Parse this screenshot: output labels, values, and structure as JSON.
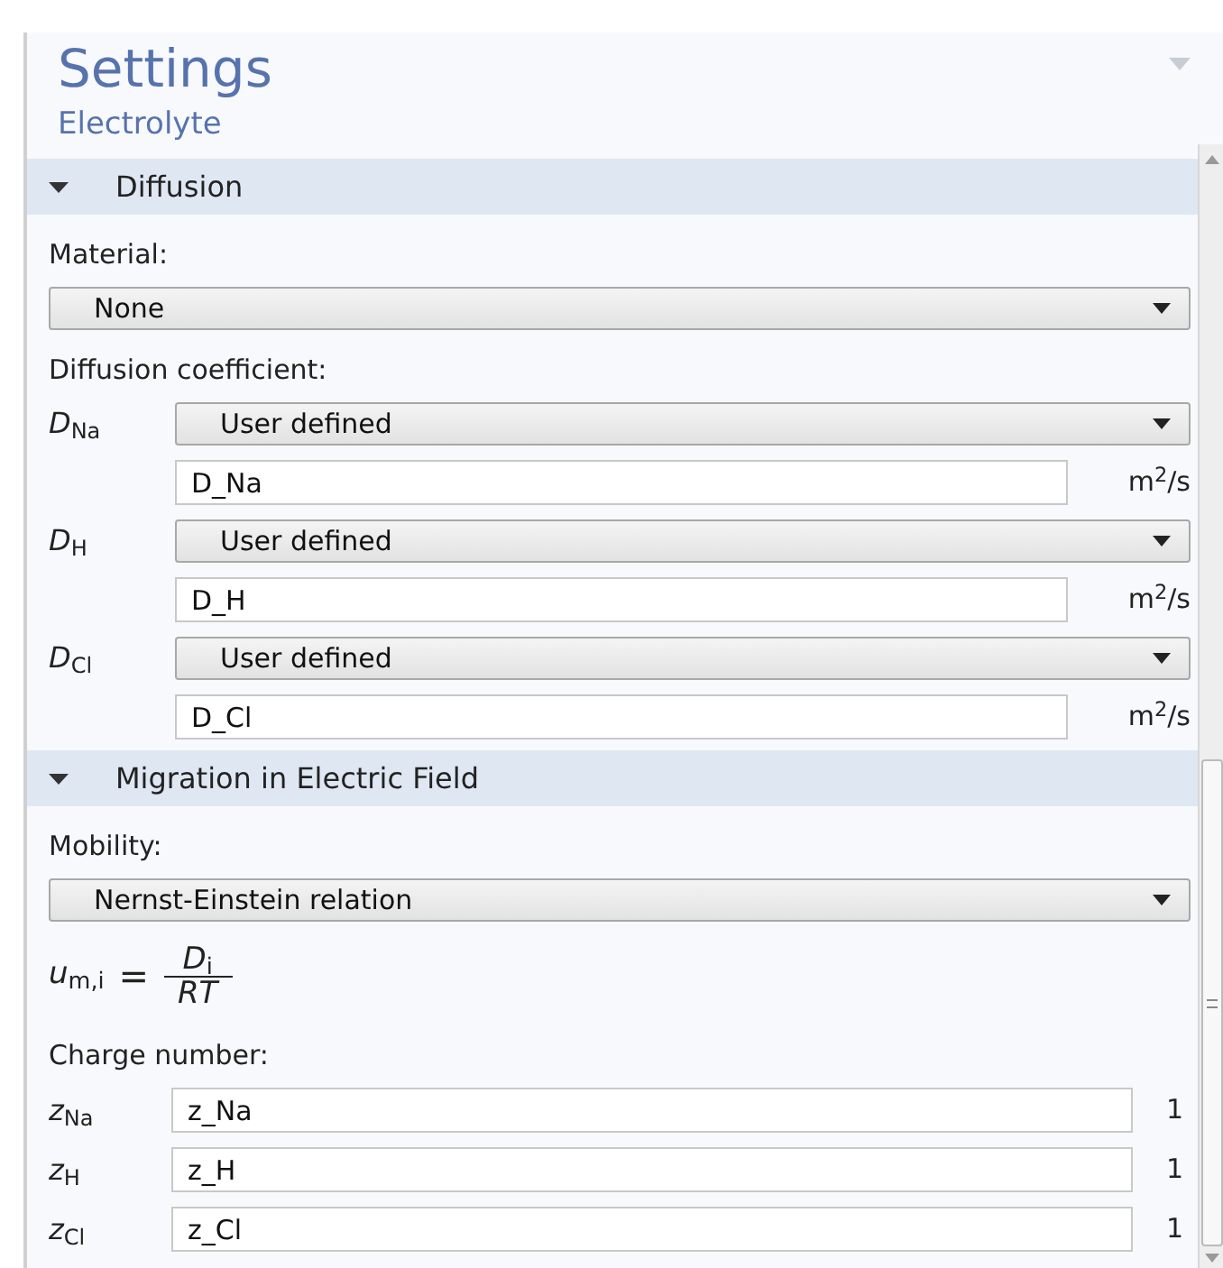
{
  "panel": {
    "title": "Settings",
    "subtitle": "Electrolyte"
  },
  "sections": [
    {
      "title": "Diffusion",
      "expanded": true,
      "items": [
        {
          "kind": "label",
          "text": "Material:"
        },
        {
          "kind": "select",
          "value": "None"
        },
        {
          "kind": "label",
          "text": "Diffusion coefficient:"
        },
        {
          "kind": "symbol-select",
          "symbol": "*D*$_{Na}$",
          "value": "User defined"
        },
        {
          "kind": "input",
          "value": "D_Na",
          "unit": "m$^{2}$/s"
        },
        {
          "kind": "symbol-select",
          "symbol": "*D*$_{H}$",
          "value": "User defined"
        },
        {
          "kind": "input",
          "value": "D_H",
          "unit": "m$^{2}$/s"
        },
        {
          "kind": "symbol-select",
          "symbol": "*D*$_{Cl}$",
          "value": "User defined"
        },
        {
          "kind": "input",
          "value": "D_Cl",
          "unit": "m$^{2}$/s"
        }
      ]
    },
    {
      "title": "Migration in Electric Field",
      "expanded": true,
      "items": [
        {
          "kind": "label",
          "text": "Mobility:"
        },
        {
          "kind": "select",
          "value": "Nernst-Einstein relation"
        },
        {
          "kind": "formula",
          "lhs": "*u*$_{m,i}$",
          "equals": "=",
          "numerator": "*D*$_{i}$",
          "denominator": "RT"
        },
        {
          "kind": "label",
          "text": "Charge number:"
        },
        {
          "kind": "symbol-input",
          "symbol": "*z*$_{Na}$",
          "value": "z_Na",
          "unit": "1"
        },
        {
          "kind": "symbol-input",
          "symbol": "*z*$_{H}$",
          "value": "z_H",
          "unit": "1"
        },
        {
          "kind": "symbol-input",
          "symbol": "*z*$_{Cl}$",
          "value": "z_Cl",
          "unit": "1"
        }
      ]
    }
  ]
}
